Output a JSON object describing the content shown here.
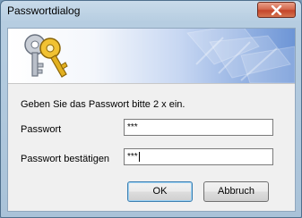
{
  "window": {
    "title": "Passwortdialog"
  },
  "icons": {
    "close": "close-icon",
    "keys": "keys-icon"
  },
  "form": {
    "prompt": "Geben Sie das Passwort bitte 2 x ein.",
    "password_label": "Passwort",
    "password_value": "***",
    "confirm_label": "Passwort bestätigen",
    "confirm_value": "***"
  },
  "buttons": {
    "ok": "OK",
    "cancel": "Abbruch"
  },
  "colors": {
    "banner_accent": "#6d95d6",
    "close_button": "#c4452a",
    "default_button_border": "#3c7fb1"
  }
}
